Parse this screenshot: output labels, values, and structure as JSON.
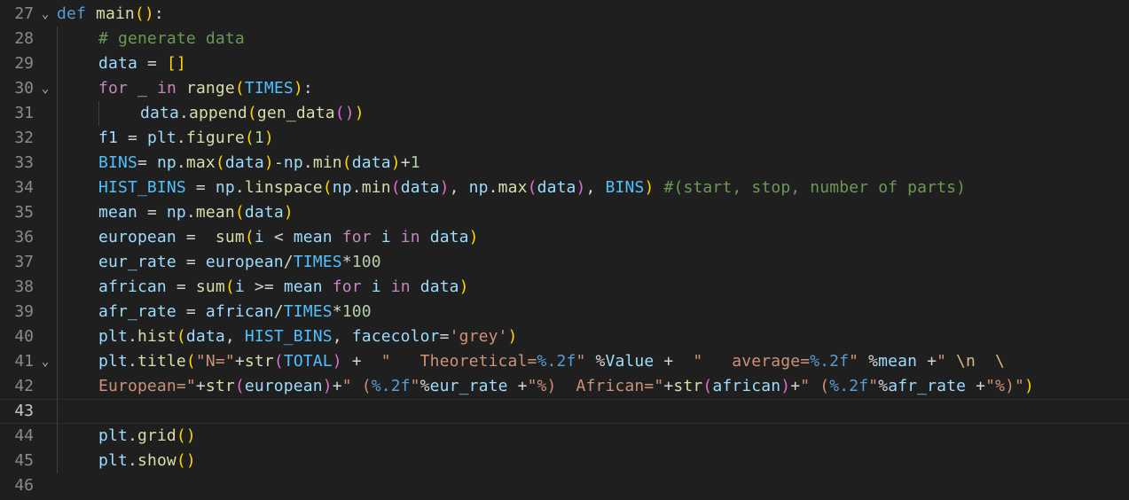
{
  "editor": {
    "lines": [
      {
        "num": "27",
        "fold": "v",
        "indent": 0,
        "tokens": [
          {
            "c": "kw-blue",
            "t": "def"
          },
          {
            "c": "op",
            "t": " "
          },
          {
            "c": "fn",
            "t": "main"
          },
          {
            "c": "b1",
            "t": "()"
          },
          {
            "c": "op",
            "t": ":"
          }
        ]
      },
      {
        "num": "28",
        "indent": 1,
        "tokens": [
          {
            "c": "cmt",
            "t": "# generate data"
          }
        ]
      },
      {
        "num": "29",
        "indent": 1,
        "tokens": [
          {
            "c": "var",
            "t": "data"
          },
          {
            "c": "op",
            "t": " = "
          },
          {
            "c": "b1",
            "t": "[]"
          }
        ]
      },
      {
        "num": "30",
        "fold": "v",
        "indent": 1,
        "tokens": [
          {
            "c": "kw-purple",
            "t": "for"
          },
          {
            "c": "op",
            "t": " "
          },
          {
            "c": "var",
            "t": "_"
          },
          {
            "c": "op",
            "t": " "
          },
          {
            "c": "kw-purple",
            "t": "in"
          },
          {
            "c": "op",
            "t": " "
          },
          {
            "c": "fn",
            "t": "range"
          },
          {
            "c": "b1",
            "t": "("
          },
          {
            "c": "const",
            "t": "TIMES"
          },
          {
            "c": "b1",
            "t": ")"
          },
          {
            "c": "op",
            "t": ":"
          }
        ]
      },
      {
        "num": "31",
        "indent": 2,
        "tokens": [
          {
            "c": "var",
            "t": "data"
          },
          {
            "c": "op",
            "t": "."
          },
          {
            "c": "fn",
            "t": "append"
          },
          {
            "c": "b1",
            "t": "("
          },
          {
            "c": "fn",
            "t": "gen_data"
          },
          {
            "c": "b2",
            "t": "()"
          },
          {
            "c": "b1",
            "t": ")"
          }
        ]
      },
      {
        "num": "32",
        "indent": 1,
        "tokens": [
          {
            "c": "var",
            "t": "f1"
          },
          {
            "c": "op",
            "t": " = "
          },
          {
            "c": "var",
            "t": "plt"
          },
          {
            "c": "op",
            "t": "."
          },
          {
            "c": "fn",
            "t": "figure"
          },
          {
            "c": "b1",
            "t": "("
          },
          {
            "c": "num",
            "t": "1"
          },
          {
            "c": "b1",
            "t": ")"
          }
        ]
      },
      {
        "num": "33",
        "indent": 1,
        "tokens": [
          {
            "c": "const",
            "t": "BINS"
          },
          {
            "c": "op",
            "t": "= "
          },
          {
            "c": "var",
            "t": "np"
          },
          {
            "c": "op",
            "t": "."
          },
          {
            "c": "fn",
            "t": "max"
          },
          {
            "c": "b1",
            "t": "("
          },
          {
            "c": "var",
            "t": "data"
          },
          {
            "c": "b1",
            "t": ")"
          },
          {
            "c": "op",
            "t": "-"
          },
          {
            "c": "var",
            "t": "np"
          },
          {
            "c": "op",
            "t": "."
          },
          {
            "c": "fn",
            "t": "min"
          },
          {
            "c": "b1",
            "t": "("
          },
          {
            "c": "var",
            "t": "data"
          },
          {
            "c": "b1",
            "t": ")"
          },
          {
            "c": "op",
            "t": "+"
          },
          {
            "c": "num",
            "t": "1"
          }
        ]
      },
      {
        "num": "34",
        "indent": 1,
        "tokens": [
          {
            "c": "const",
            "t": "HIST_BINS"
          },
          {
            "c": "op",
            "t": " = "
          },
          {
            "c": "var",
            "t": "np"
          },
          {
            "c": "op",
            "t": "."
          },
          {
            "c": "fn",
            "t": "linspace"
          },
          {
            "c": "b1",
            "t": "("
          },
          {
            "c": "var",
            "t": "np"
          },
          {
            "c": "op",
            "t": "."
          },
          {
            "c": "fn",
            "t": "min"
          },
          {
            "c": "b2",
            "t": "("
          },
          {
            "c": "var",
            "t": "data"
          },
          {
            "c": "b2",
            "t": ")"
          },
          {
            "c": "op",
            "t": ", "
          },
          {
            "c": "var",
            "t": "np"
          },
          {
            "c": "op",
            "t": "."
          },
          {
            "c": "fn",
            "t": "max"
          },
          {
            "c": "b2",
            "t": "("
          },
          {
            "c": "var",
            "t": "data"
          },
          {
            "c": "b2",
            "t": ")"
          },
          {
            "c": "op",
            "t": ", "
          },
          {
            "c": "const",
            "t": "BINS"
          },
          {
            "c": "b1",
            "t": ")"
          },
          {
            "c": "op",
            "t": " "
          },
          {
            "c": "cmt",
            "t": "#(start, stop, number of parts)"
          }
        ]
      },
      {
        "num": "35",
        "indent": 1,
        "tokens": [
          {
            "c": "var",
            "t": "mean"
          },
          {
            "c": "op",
            "t": " = "
          },
          {
            "c": "var",
            "t": "np"
          },
          {
            "c": "op",
            "t": "."
          },
          {
            "c": "fn",
            "t": "mean"
          },
          {
            "c": "b1",
            "t": "("
          },
          {
            "c": "var",
            "t": "data"
          },
          {
            "c": "b1",
            "t": ")"
          }
        ]
      },
      {
        "num": "36",
        "indent": 1,
        "tokens": [
          {
            "c": "var",
            "t": "european"
          },
          {
            "c": "op",
            "t": " =  "
          },
          {
            "c": "fn",
            "t": "sum"
          },
          {
            "c": "b1",
            "t": "("
          },
          {
            "c": "var",
            "t": "i"
          },
          {
            "c": "op",
            "t": " < "
          },
          {
            "c": "var",
            "t": "mean"
          },
          {
            "c": "op",
            "t": " "
          },
          {
            "c": "kw-purple",
            "t": "for"
          },
          {
            "c": "op",
            "t": " "
          },
          {
            "c": "var",
            "t": "i"
          },
          {
            "c": "op",
            "t": " "
          },
          {
            "c": "kw-purple",
            "t": "in"
          },
          {
            "c": "op",
            "t": " "
          },
          {
            "c": "var",
            "t": "data"
          },
          {
            "c": "b1",
            "t": ")"
          }
        ]
      },
      {
        "num": "37",
        "indent": 1,
        "tokens": [
          {
            "c": "var",
            "t": "eur_rate"
          },
          {
            "c": "op",
            "t": " = "
          },
          {
            "c": "var",
            "t": "european"
          },
          {
            "c": "op",
            "t": "/"
          },
          {
            "c": "const",
            "t": "TIMES"
          },
          {
            "c": "op",
            "t": "*"
          },
          {
            "c": "num",
            "t": "100"
          }
        ]
      },
      {
        "num": "38",
        "indent": 1,
        "tokens": [
          {
            "c": "var",
            "t": "african"
          },
          {
            "c": "op",
            "t": " = "
          },
          {
            "c": "fn",
            "t": "sum"
          },
          {
            "c": "b1",
            "t": "("
          },
          {
            "c": "var",
            "t": "i"
          },
          {
            "c": "op",
            "t": " >= "
          },
          {
            "c": "var",
            "t": "mean"
          },
          {
            "c": "op",
            "t": " "
          },
          {
            "c": "kw-purple",
            "t": "for"
          },
          {
            "c": "op",
            "t": " "
          },
          {
            "c": "var",
            "t": "i"
          },
          {
            "c": "op",
            "t": " "
          },
          {
            "c": "kw-purple",
            "t": "in"
          },
          {
            "c": "op",
            "t": " "
          },
          {
            "c": "var",
            "t": "data"
          },
          {
            "c": "b1",
            "t": ")"
          }
        ]
      },
      {
        "num": "39",
        "indent": 1,
        "tokens": [
          {
            "c": "var",
            "t": "afr_rate"
          },
          {
            "c": "op",
            "t": " = "
          },
          {
            "c": "var",
            "t": "african"
          },
          {
            "c": "op",
            "t": "/"
          },
          {
            "c": "const",
            "t": "TIMES"
          },
          {
            "c": "op",
            "t": "*"
          },
          {
            "c": "num",
            "t": "100"
          }
        ]
      },
      {
        "num": "40",
        "indent": 1,
        "tokens": [
          {
            "c": "var",
            "t": "plt"
          },
          {
            "c": "op",
            "t": "."
          },
          {
            "c": "fn",
            "t": "hist"
          },
          {
            "c": "b1",
            "t": "("
          },
          {
            "c": "var",
            "t": "data"
          },
          {
            "c": "op",
            "t": ", "
          },
          {
            "c": "const",
            "t": "HIST_BINS"
          },
          {
            "c": "op",
            "t": ", "
          },
          {
            "c": "var",
            "t": "facecolor"
          },
          {
            "c": "op",
            "t": "="
          },
          {
            "c": "str",
            "t": "'grey'"
          },
          {
            "c": "b1",
            "t": ")"
          }
        ]
      },
      {
        "num": "41",
        "fold": "v",
        "indent": 1,
        "tokens": [
          {
            "c": "var",
            "t": "plt"
          },
          {
            "c": "op",
            "t": "."
          },
          {
            "c": "fn",
            "t": "title"
          },
          {
            "c": "b1",
            "t": "("
          },
          {
            "c": "str",
            "t": "\"N=\""
          },
          {
            "c": "op",
            "t": "+"
          },
          {
            "c": "fn",
            "t": "str"
          },
          {
            "c": "b2",
            "t": "("
          },
          {
            "c": "const",
            "t": "TOTAL"
          },
          {
            "c": "b2",
            "t": ")"
          },
          {
            "c": "op",
            "t": " +  "
          },
          {
            "c": "str",
            "t": "\"   Theoretical="
          },
          {
            "c": "fmt",
            "t": "%.2f"
          },
          {
            "c": "str",
            "t": "\""
          },
          {
            "c": "op",
            "t": " %"
          },
          {
            "c": "var",
            "t": "Value"
          },
          {
            "c": "op",
            "t": " +  "
          },
          {
            "c": "str",
            "t": "\"   average="
          },
          {
            "c": "fmt",
            "t": "%.2f"
          },
          {
            "c": "str",
            "t": "\""
          },
          {
            "c": "op",
            "t": " %"
          },
          {
            "c": "var",
            "t": "mean"
          },
          {
            "c": "op",
            "t": " +"
          },
          {
            "c": "str",
            "t": "\" "
          },
          {
            "c": "esc",
            "t": "\\n"
          },
          {
            "c": "str",
            "t": "  "
          },
          {
            "c": "esc",
            "t": "\\"
          }
        ]
      },
      {
        "num": "42",
        "indent": 1,
        "tokens": [
          {
            "c": "str",
            "t": "European=\""
          },
          {
            "c": "op",
            "t": "+"
          },
          {
            "c": "fn",
            "t": "str"
          },
          {
            "c": "b2",
            "t": "("
          },
          {
            "c": "var",
            "t": "european"
          },
          {
            "c": "b2",
            "t": ")"
          },
          {
            "c": "op",
            "t": "+"
          },
          {
            "c": "str",
            "t": "\" ("
          },
          {
            "c": "fmt",
            "t": "%.2f"
          },
          {
            "c": "str",
            "t": "\""
          },
          {
            "c": "op",
            "t": "%"
          },
          {
            "c": "var",
            "t": "eur_rate"
          },
          {
            "c": "op",
            "t": " +"
          },
          {
            "c": "str",
            "t": "\"%)  African=\""
          },
          {
            "c": "op",
            "t": "+"
          },
          {
            "c": "fn",
            "t": "str"
          },
          {
            "c": "b2",
            "t": "("
          },
          {
            "c": "var",
            "t": "african"
          },
          {
            "c": "b2",
            "t": ")"
          },
          {
            "c": "op",
            "t": "+"
          },
          {
            "c": "str",
            "t": "\" ("
          },
          {
            "c": "fmt",
            "t": "%.2f"
          },
          {
            "c": "str",
            "t": "\""
          },
          {
            "c": "op",
            "t": "%"
          },
          {
            "c": "var",
            "t": "afr_rate"
          },
          {
            "c": "op",
            "t": " +"
          },
          {
            "c": "str",
            "t": "\"%)\""
          },
          {
            "c": "b1",
            "t": ")"
          }
        ]
      },
      {
        "num": "43",
        "indent": 1,
        "current": true,
        "tokens": []
      },
      {
        "num": "44",
        "indent": 1,
        "tokens": [
          {
            "c": "var",
            "t": "plt"
          },
          {
            "c": "op",
            "t": "."
          },
          {
            "c": "fn",
            "t": "grid"
          },
          {
            "c": "b1",
            "t": "()"
          }
        ]
      },
      {
        "num": "45",
        "indent": 1,
        "tokens": [
          {
            "c": "var",
            "t": "plt"
          },
          {
            "c": "op",
            "t": "."
          },
          {
            "c": "fn",
            "t": "show"
          },
          {
            "c": "b1",
            "t": "()"
          }
        ]
      },
      {
        "num": "46",
        "indent": 0,
        "tokens": []
      }
    ]
  }
}
